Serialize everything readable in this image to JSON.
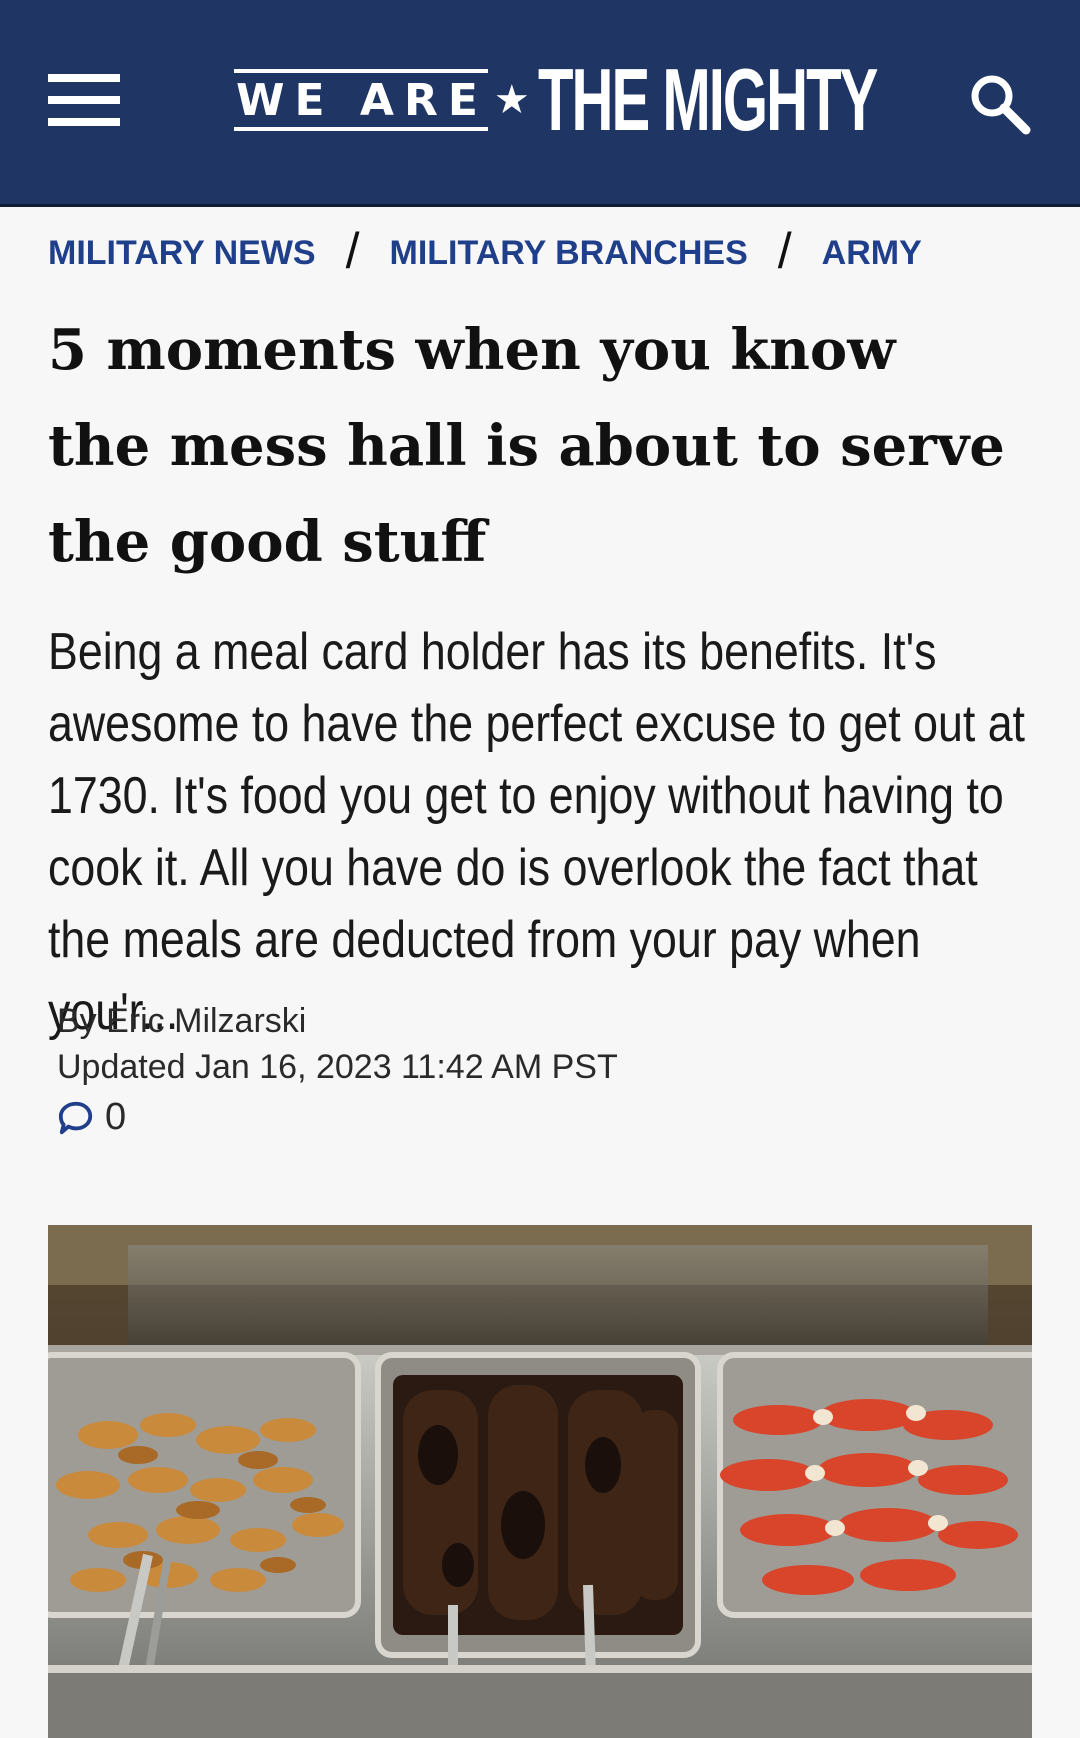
{
  "header": {
    "logo_we_are": "WE ARE",
    "logo_star": "★",
    "logo_the_mighty": "THE MIGHTY",
    "background_color": "#1f3563"
  },
  "breadcrumb": {
    "items": [
      "MILITARY NEWS",
      "MILITARY BRANCHES",
      "ARMY"
    ],
    "separator": "/"
  },
  "article": {
    "title": "5 moments when you know the mess hall is about to serve the good stuff",
    "excerpt": "Being a meal card holder has its benefits. It's awesome to have the perfect excuse to get out at 1730. It's food you get to enjoy without having to cook it. All you have do is overlook the fact that the meals are deducted from your pay when you'r...",
    "byline": "By Eric Milzarski",
    "updated": "Updated Jan 16, 2023 11:42 AM PST",
    "comment_count": "0"
  },
  "icons": {
    "menu": "hamburger-menu-icon",
    "search": "search-icon",
    "comment": "comment-bubble-icon"
  },
  "colors": {
    "accent_link": "#1f3f8a",
    "page_bg": "#f7f7f7"
  }
}
